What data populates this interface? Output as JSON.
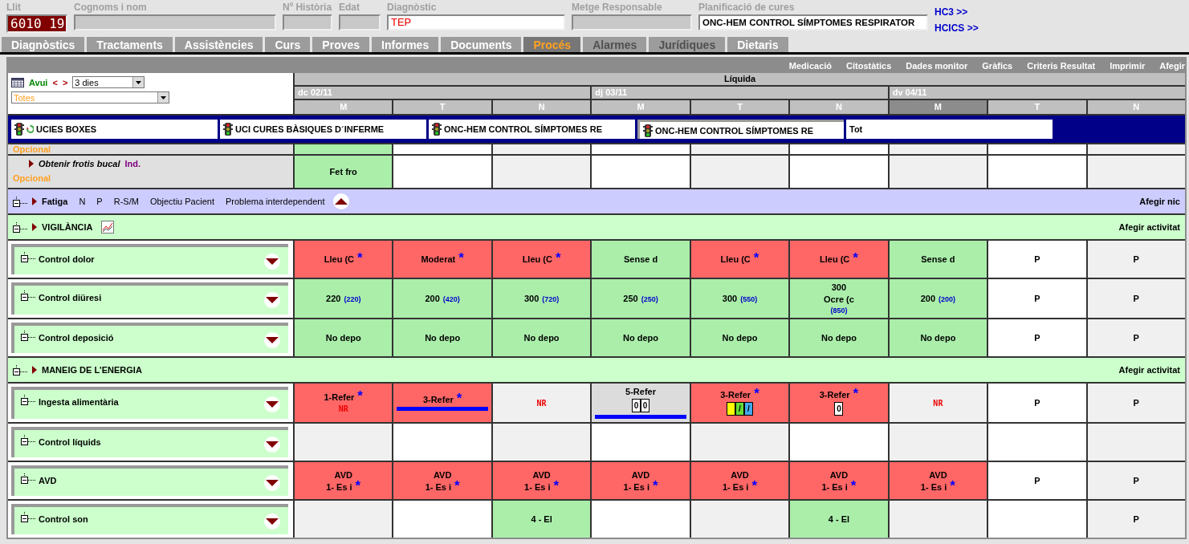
{
  "header": {
    "bed": {
      "label": "Llit",
      "value": "6010 19"
    },
    "name": {
      "label": "Cognoms i nom"
    },
    "history": {
      "label": "Nº Història"
    },
    "age": {
      "label": "Edat"
    },
    "diagnosis": {
      "label": "Diagnòstic",
      "value": "TEP"
    },
    "doctor": {
      "label": "Metge Responsable"
    },
    "care_plan": {
      "label": "Planificació de cures",
      "value": "ONC-HEM CONTROL SÍMPTOMES RESPIRATOR"
    },
    "links": [
      "HC3 >>",
      "HCICS >>"
    ]
  },
  "tabs": [
    {
      "label": "Diagnòstics",
      "selected": false,
      "disabled": false
    },
    {
      "label": "Tractaments",
      "selected": false,
      "disabled": false
    },
    {
      "label": "Assistències",
      "selected": false,
      "disabled": false
    },
    {
      "label": "Curs",
      "selected": false,
      "disabled": false
    },
    {
      "label": "Proves",
      "selected": false,
      "disabled": false
    },
    {
      "label": "Informes",
      "selected": false,
      "disabled": false
    },
    {
      "label": "Documents",
      "selected": false,
      "disabled": false
    },
    {
      "label": "Procés",
      "selected": true,
      "disabled": false
    },
    {
      "label": "Alarmes",
      "selected": false,
      "disabled": true
    },
    {
      "label": "Jurídiques",
      "selected": false,
      "disabled": true
    },
    {
      "label": "Dietaris",
      "selected": false,
      "disabled": false
    }
  ],
  "toolbar": [
    "Medicació",
    "Citostàtics",
    "Dades monitor",
    "Gràfics",
    "Criteris Resultat",
    "Imprimir",
    "Afegir"
  ],
  "controls": {
    "today": "Avui",
    "prev": "<",
    "next": ">",
    "range": "3 dies",
    "filter": "Totes"
  },
  "grid_header": {
    "title": "Líquida",
    "days": [
      {
        "label": "dc 02/11",
        "shifts": [
          {
            "label": "M",
            "selected": false
          },
          {
            "label": "T",
            "selected": false
          },
          {
            "label": "N",
            "selected": false
          }
        ]
      },
      {
        "label": "dj 03/11",
        "shifts": [
          {
            "label": "M",
            "selected": false
          },
          {
            "label": "T",
            "selected": false
          },
          {
            "label": "N",
            "selected": false
          }
        ]
      },
      {
        "label": "dv 04/11",
        "shifts": [
          {
            "label": "M",
            "selected": true
          },
          {
            "label": "T",
            "selected": false
          },
          {
            "label": "N",
            "selected": false
          }
        ]
      }
    ]
  },
  "plan_tabs": [
    {
      "label": "UCIES BOXES",
      "kind": "refresh",
      "selected": false
    },
    {
      "label": "UCI CURES BÀSIQUES D´INFERME",
      "kind": "light",
      "selected": false
    },
    {
      "label": "ONC-HEM CONTROL SÍMPTOMES RE",
      "kind": "light",
      "selected": false
    },
    {
      "label": "ONC-HEM CONTROL SÍMPTOMES RE",
      "kind": "light",
      "selected": true
    },
    {
      "label": "Tot",
      "kind": "plain",
      "selected": false
    }
  ],
  "rows": [
    {
      "kind": "item",
      "note": "Opcional",
      "cells": [
        {
          "kind": "ok"
        },
        {
          "kind": "empty"
        },
        {
          "kind": "empty"
        },
        {
          "kind": "empty"
        },
        {
          "kind": "empty"
        },
        {
          "kind": "empty"
        },
        {
          "kind": "empty"
        },
        {
          "kind": "empty"
        },
        {
          "kind": "empty"
        }
      ]
    },
    {
      "kind": "item",
      "label": "Obtenir frotis bucal",
      "tag": "Ind.",
      "note": "Opcional",
      "cells": [
        {
          "kind": "ok",
          "text": "Fet fro"
        },
        {
          "kind": "empty"
        },
        {
          "kind": "empty"
        },
        {
          "kind": "empty"
        },
        {
          "kind": "empty"
        },
        {
          "kind": "empty"
        },
        {
          "kind": "empty"
        },
        {
          "kind": "empty"
        },
        {
          "kind": "empty"
        }
      ]
    },
    {
      "kind": "problem",
      "label": "Fatiga",
      "options": [
        "N",
        "P",
        "R-S/M",
        "Objectiu Pacient",
        "Problema interdependent"
      ],
      "action": "Afegir nic"
    },
    {
      "kind": "group",
      "label": "VIGILÀNCIA",
      "chart": true,
      "action": "Afegir activitat"
    },
    {
      "kind": "activity",
      "label": "Control dolor",
      "cells": [
        {
          "kind": "alert",
          "text": "Lleu (C",
          "mark": "*"
        },
        {
          "kind": "alert",
          "text": "Moderat",
          "mark": "*"
        },
        {
          "kind": "alert",
          "text": "Lleu (C",
          "mark": "*"
        },
        {
          "kind": "ok",
          "text": "Sense d"
        },
        {
          "kind": "alert",
          "text": "Lleu (C",
          "mark": "*"
        },
        {
          "kind": "alert",
          "text": "Lleu (C",
          "mark": "*"
        },
        {
          "kind": "ok",
          "text": "Sense d"
        },
        {
          "kind": "empty",
          "text": "P"
        },
        {
          "kind": "empty",
          "text": "P"
        }
      ]
    },
    {
      "kind": "activity",
      "label": "Control diüresi",
      "cells": [
        {
          "kind": "ok",
          "text": "220",
          "total": "(220)"
        },
        {
          "kind": "ok",
          "text": "200",
          "total": "(420)"
        },
        {
          "kind": "ok",
          "text": "300",
          "total": "(720)"
        },
        {
          "kind": "ok",
          "text": "250",
          "total": "(250)"
        },
        {
          "kind": "ok",
          "text": "300",
          "total": "(550)"
        },
        {
          "kind": "ok",
          "text": "300",
          "sub": "Ocre (c",
          "total": "(850)"
        },
        {
          "kind": "ok",
          "text": "200",
          "total": "(200)"
        },
        {
          "kind": "empty",
          "text": "P"
        },
        {
          "kind": "empty",
          "text": "P"
        }
      ]
    },
    {
      "kind": "activity",
      "label": "Control deposició",
      "cells": [
        {
          "kind": "ok",
          "text": "No depo"
        },
        {
          "kind": "ok",
          "text": "No depo"
        },
        {
          "kind": "ok",
          "text": "No depo"
        },
        {
          "kind": "ok",
          "text": "No depo"
        },
        {
          "kind": "ok",
          "text": "No depo"
        },
        {
          "kind": "ok",
          "text": "No depo"
        },
        {
          "kind": "ok",
          "text": "No depo"
        },
        {
          "kind": "empty",
          "text": "P"
        },
        {
          "kind": "empty",
          "text": "P"
        }
      ]
    },
    {
      "kind": "group",
      "label": "MANEIG DE L'ENERGIA",
      "chart": false,
      "action": "Afegir activitat"
    },
    {
      "kind": "activity",
      "label": "Ingesta alimentària",
      "cells": [
        {
          "kind": "alert",
          "text": "1-Refer",
          "mark": "*",
          "flag": "NR"
        },
        {
          "kind": "alert",
          "text": "3-Refer",
          "mark": "*",
          "bar": true
        },
        {
          "kind": "empty",
          "flag": "NR"
        },
        {
          "kind": "neutral",
          "text": "5-Refer",
          "boxes": [
            {
              "text": "0"
            },
            {
              "text": "0"
            }
          ],
          "bar": true
        },
        {
          "kind": "alert",
          "text": "3-Refer",
          "mark": "*",
          "boxes": [
            {
              "color": "#ffff00"
            },
            {
              "text": "/",
              "color": "#66dd33"
            },
            {
              "text": "/",
              "color": "#44aaee"
            }
          ]
        },
        {
          "kind": "alert",
          "text": "3-Refer",
          "mark": "*",
          "boxes": [
            {
              "text": "0"
            }
          ]
        },
        {
          "kind": "empty",
          "flag": "NR"
        },
        {
          "kind": "empty",
          "text": "P"
        },
        {
          "kind": "empty",
          "text": "P"
        }
      ]
    },
    {
      "kind": "activity",
      "label": "Control líquids",
      "cells": [
        {
          "kind": "empty"
        },
        {
          "kind": "empty"
        },
        {
          "kind": "empty"
        },
        {
          "kind": "empty"
        },
        {
          "kind": "empty"
        },
        {
          "kind": "empty"
        },
        {
          "kind": "empty"
        },
        {
          "kind": "empty"
        },
        {
          "kind": "empty"
        }
      ]
    },
    {
      "kind": "activity",
      "label": "AVD",
      "cells": [
        {
          "kind": "alert",
          "text": "AVD",
          "sub": "1- Es i",
          "mark": "*"
        },
        {
          "kind": "alert",
          "text": "AVD",
          "sub": "1- Es i",
          "mark": "*"
        },
        {
          "kind": "alert",
          "text": "AVD",
          "sub": "1- Es i",
          "mark": "*"
        },
        {
          "kind": "alert",
          "text": "AVD",
          "sub": "1- Es i",
          "mark": "*"
        },
        {
          "kind": "alert",
          "text": "AVD",
          "sub": "1- Es i",
          "mark": "*"
        },
        {
          "kind": "alert",
          "text": "AVD",
          "sub": "1- Es i",
          "mark": "*"
        },
        {
          "kind": "alert",
          "text": "AVD",
          "sub": "1- Es i",
          "mark": "*"
        },
        {
          "kind": "empty",
          "text": "P"
        },
        {
          "kind": "empty",
          "text": "P"
        }
      ]
    },
    {
      "kind": "activity",
      "label": "Control son",
      "cells": [
        {
          "kind": "empty"
        },
        {
          "kind": "empty"
        },
        {
          "kind": "ok",
          "text": "4 - El"
        },
        {
          "kind": "empty"
        },
        {
          "kind": "empty"
        },
        {
          "kind": "ok",
          "text": "4 - El"
        },
        {
          "kind": "empty"
        },
        {
          "kind": "empty"
        },
        {
          "kind": "empty",
          "text": "P"
        }
      ]
    }
  ]
}
